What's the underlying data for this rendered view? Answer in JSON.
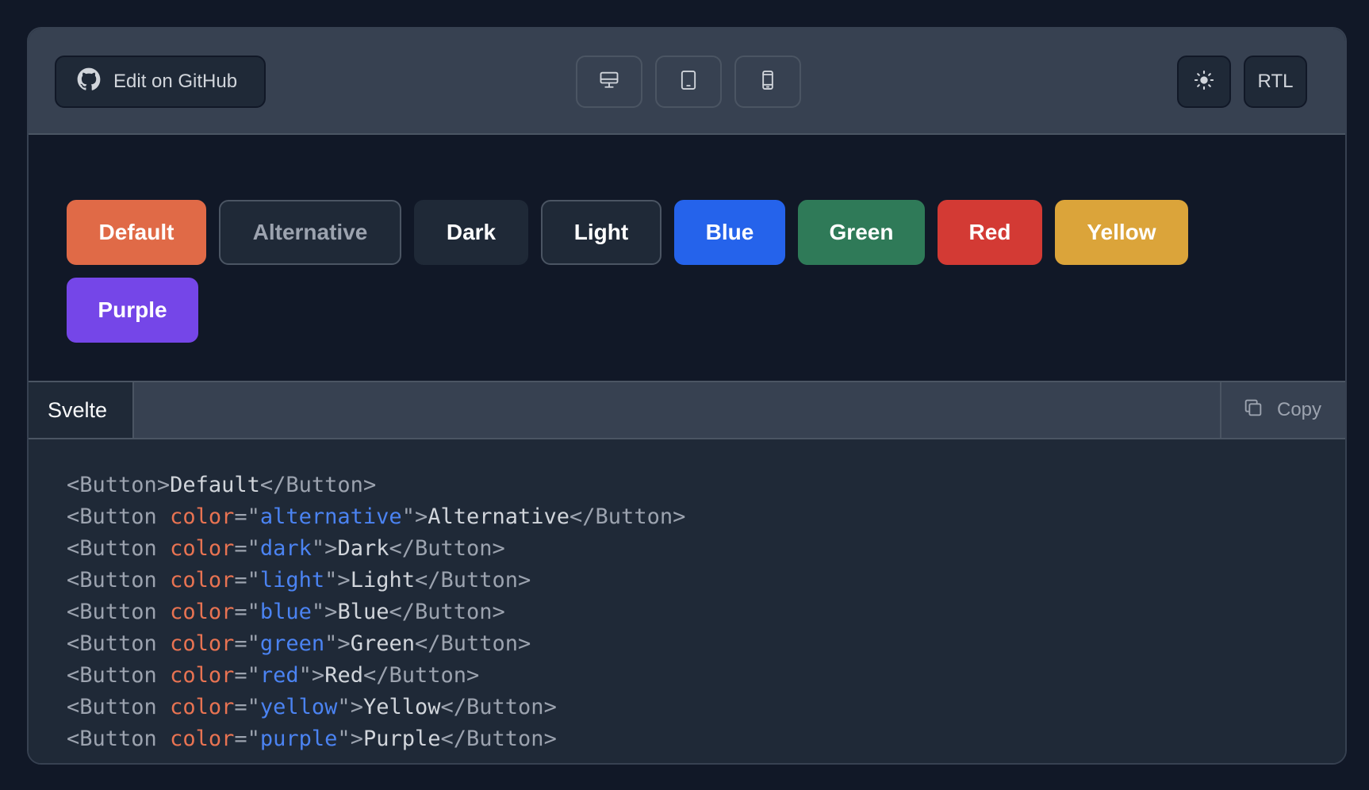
{
  "toolbar": {
    "github_label": "Edit on GitHub",
    "rtl_label": "RTL",
    "icons": {
      "github": "github-icon",
      "desktop": "desktop-icon",
      "tablet": "tablet-icon",
      "mobile": "mobile-icon",
      "theme": "sun-icon"
    }
  },
  "buttons": [
    {
      "label": "Default",
      "bg": "#e06a47",
      "border": "#e06a47",
      "color": "#ffffff"
    },
    {
      "label": "Alternative",
      "bg": "#1f2937",
      "border": "#4b5563",
      "color": "#9ca3af"
    },
    {
      "label": "Dark",
      "bg": "#1f2937",
      "border": "#1f2937",
      "color": "#ffffff"
    },
    {
      "label": "Light",
      "bg": "#1f2937",
      "border": "#4b5563",
      "color": "#ffffff"
    },
    {
      "label": "Blue",
      "bg": "#2563eb",
      "border": "#2563eb",
      "color": "#ffffff"
    },
    {
      "label": "Green",
      "bg": "#2f7a58",
      "border": "#2f7a58",
      "color": "#ffffff"
    },
    {
      "label": "Red",
      "bg": "#d33a34",
      "border": "#d33a34",
      "color": "#ffffff"
    },
    {
      "label": "Yellow",
      "bg": "#dba43a",
      "border": "#dba43a",
      "color": "#ffffff"
    },
    {
      "label": "Purple",
      "bg": "#7546e8",
      "border": "#7546e8",
      "color": "#ffffff"
    }
  ],
  "code_panel": {
    "tab_label": "Svelte",
    "copy_label": "Copy",
    "copy_icon": "copy-icon"
  },
  "code_lines": [
    {
      "attr": "",
      "value": "",
      "text": "Default"
    },
    {
      "attr": "color",
      "value": "alternative",
      "text": "Alternative"
    },
    {
      "attr": "color",
      "value": "dark",
      "text": "Dark"
    },
    {
      "attr": "color",
      "value": "light",
      "text": "Light"
    },
    {
      "attr": "color",
      "value": "blue",
      "text": "Blue"
    },
    {
      "attr": "color",
      "value": "green",
      "text": "Green"
    },
    {
      "attr": "color",
      "value": "red",
      "text": "Red"
    },
    {
      "attr": "color",
      "value": "yellow",
      "text": "Yellow"
    },
    {
      "attr": "color",
      "value": "purple",
      "text": "Purple"
    }
  ],
  "code_tag": "Button"
}
